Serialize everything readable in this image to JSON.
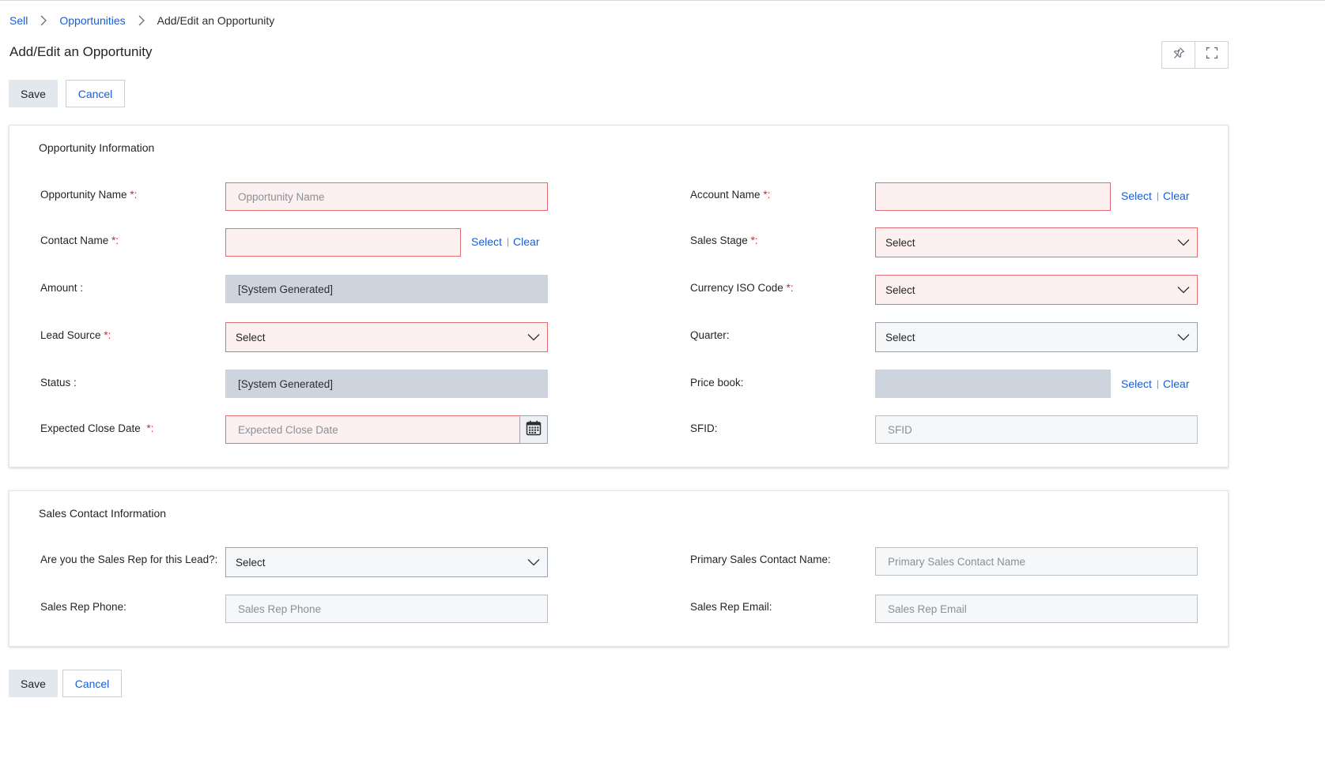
{
  "breadcrumb": {
    "items": [
      "Sell",
      "Opportunities"
    ],
    "current": "Add/Edit an Opportunity"
  },
  "page_title": "Add/Edit an Opportunity",
  "toolbar": {
    "save_label": "Save",
    "cancel_label": "Cancel"
  },
  "top_tools": {
    "pin_icon": "pin-icon",
    "expand_icon": "fullscreen-icon"
  },
  "opportunity_info": {
    "title": "Opportunity Information",
    "opportunity_name": {
      "label": "Opportunity Name",
      "placeholder": "Opportunity Name"
    },
    "account_name": {
      "label": "Account Name",
      "select": "Select",
      "clear": "Clear"
    },
    "contact_name": {
      "label": "Contact Name",
      "select": "Select",
      "clear": "Clear"
    },
    "sales_stage": {
      "label": "Sales Stage",
      "value": "Select"
    },
    "amount": {
      "label": "Amount :",
      "value": "[System Generated]"
    },
    "currency": {
      "label": "Currency ISO Code",
      "value": "Select"
    },
    "lead_source": {
      "label": "Lead Source",
      "value": "Select"
    },
    "quarter": {
      "label": "Quarter:",
      "value": "Select"
    },
    "status": {
      "label": "Status :",
      "value": "[System Generated]"
    },
    "price_book": {
      "label": "Price book:",
      "select": "Select",
      "clear": "Clear"
    },
    "close_date": {
      "label": "Expected Close Date",
      "placeholder": "Expected Close Date"
    },
    "sfid": {
      "label": "SFID:",
      "placeholder": "SFID"
    }
  },
  "sales_contact": {
    "title": "Sales Contact Information",
    "sales_rep_question": {
      "label": "Are you the Sales Rep for this Lead?:",
      "value": "Select"
    },
    "primary_contact": {
      "label": "Primary Sales Contact Name:",
      "placeholder": "Primary Sales Contact Name"
    },
    "rep_phone": {
      "label": "Sales Rep Phone:",
      "placeholder": "Sales Rep Phone"
    },
    "rep_email": {
      "label": "Sales Rep Email:",
      "placeholder": "Sales Rep Email"
    }
  },
  "required_marker": "*:",
  "colors": {
    "link": "#1a5fd0",
    "required_border": "#e06d72",
    "required_bg": "#fdf0f0",
    "readonly_bg": "#cdd4de"
  }
}
